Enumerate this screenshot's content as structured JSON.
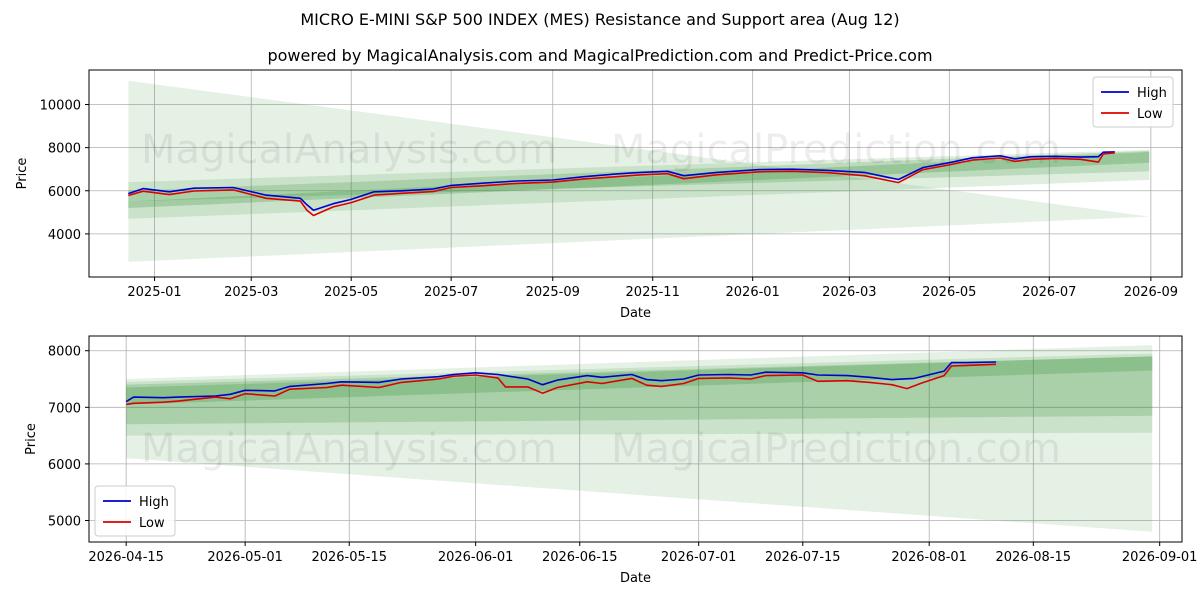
{
  "header": {
    "title": "MICRO E-MINI S&P 500 INDEX (MES) Resistance and Support area (Aug 12)",
    "subtitle": "powered by MagicalAnalysis.com and MagicalPrediction.com and Predict-Price.com"
  },
  "watermark": {
    "left": "MagicalAnalysis.com",
    "right": "MagicalPrediction.com"
  },
  "colors": {
    "high": "#0000cc",
    "low": "#dd0000",
    "band": "#2e8b2e",
    "grid": "#b0b0b0"
  },
  "chart_data": [
    {
      "type": "line",
      "xlabel": "Date",
      "ylabel": "Price",
      "grid": true,
      "legend": "top-right",
      "xticks": [
        "2025-01",
        "2025-03",
        "2025-05",
        "2025-07",
        "2025-09",
        "2025-11",
        "2026-01",
        "2026-03",
        "2026-05",
        "2026-07",
        "2026-09"
      ],
      "yticks": [
        4000,
        6000,
        8000,
        10000
      ],
      "xlim": [
        "2024-11-22",
        "2026-09-20"
      ],
      "ylim": [
        2000,
        11600
      ],
      "series": [
        {
          "name": "High",
          "color": "#0000cc",
          "points": [
            [
              "2024-12-16",
              5870
            ],
            [
              "2024-12-25",
              6100
            ],
            [
              "2025-01-10",
              5950
            ],
            [
              "2025-01-25",
              6120
            ],
            [
              "2025-02-18",
              6150
            ],
            [
              "2025-03-10",
              5800
            ],
            [
              "2025-03-31",
              5650
            ],
            [
              "2025-04-04",
              5350
            ],
            [
              "2025-04-08",
              5100
            ],
            [
              "2025-04-20",
              5400
            ],
            [
              "2025-05-01",
              5600
            ],
            [
              "2025-05-15",
              5950
            ],
            [
              "2025-06-01",
              6000
            ],
            [
              "2025-06-20",
              6080
            ],
            [
              "2025-07-01",
              6250
            ],
            [
              "2025-07-20",
              6350
            ],
            [
              "2025-08-10",
              6450
            ],
            [
              "2025-09-01",
              6500
            ],
            [
              "2025-09-20",
              6650
            ],
            [
              "2025-10-10",
              6780
            ],
            [
              "2025-10-25",
              6850
            ],
            [
              "2025-11-10",
              6900
            ],
            [
              "2025-11-20",
              6700
            ],
            [
              "2025-12-10",
              6850
            ],
            [
              "2026-01-05",
              6980
            ],
            [
              "2026-01-25",
              7000
            ],
            [
              "2026-02-15",
              6950
            ],
            [
              "2026-03-10",
              6850
            ],
            [
              "2026-03-31",
              6520
            ],
            [
              "2026-04-15",
              7080
            ],
            [
              "2026-05-01",
              7300
            ],
            [
              "2026-05-15",
              7530
            ],
            [
              "2026-06-01",
              7620
            ],
            [
              "2026-06-10",
              7480
            ],
            [
              "2026-06-20",
              7580
            ],
            [
              "2026-07-05",
              7600
            ],
            [
              "2026-07-20",
              7560
            ],
            [
              "2026-07-31",
              7580
            ],
            [
              "2026-08-03",
              7790
            ],
            [
              "2026-08-10",
              7800
            ]
          ]
        },
        {
          "name": "Low",
          "color": "#dd0000",
          "points": [
            [
              "2024-12-16",
              5780
            ],
            [
              "2024-12-25",
              5980
            ],
            [
              "2025-01-10",
              5820
            ],
            [
              "2025-01-25",
              5990
            ],
            [
              "2025-02-18",
              6040
            ],
            [
              "2025-03-10",
              5650
            ],
            [
              "2025-03-31",
              5520
            ],
            [
              "2025-04-04",
              5100
            ],
            [
              "2025-04-08",
              4850
            ],
            [
              "2025-04-20",
              5250
            ],
            [
              "2025-05-01",
              5450
            ],
            [
              "2025-05-15",
              5800
            ],
            [
              "2025-06-01",
              5880
            ],
            [
              "2025-06-20",
              5960
            ],
            [
              "2025-07-01",
              6150
            ],
            [
              "2025-07-20",
              6230
            ],
            [
              "2025-08-10",
              6340
            ],
            [
              "2025-09-01",
              6400
            ],
            [
              "2025-09-20",
              6550
            ],
            [
              "2025-10-10",
              6650
            ],
            [
              "2025-10-25",
              6740
            ],
            [
              "2025-11-10",
              6790
            ],
            [
              "2025-11-20",
              6560
            ],
            [
              "2025-12-10",
              6740
            ],
            [
              "2026-01-05",
              6880
            ],
            [
              "2026-01-25",
              6900
            ],
            [
              "2026-02-15",
              6840
            ],
            [
              "2026-03-10",
              6700
            ],
            [
              "2026-03-31",
              6380
            ],
            [
              "2026-04-15",
              6980
            ],
            [
              "2026-05-01",
              7200
            ],
            [
              "2026-05-15",
              7420
            ],
            [
              "2026-06-01",
              7520
            ],
            [
              "2026-06-10",
              7360
            ],
            [
              "2026-06-20",
              7460
            ],
            [
              "2026-07-05",
              7500
            ],
            [
              "2026-07-20",
              7460
            ],
            [
              "2026-07-31",
              7330
            ],
            [
              "2026-08-03",
              7710
            ],
            [
              "2026-08-10",
              7760
            ]
          ]
        }
      ],
      "bands": [
        {
          "x": [
            "2024-12-16",
            "2026-08-31"
          ],
          "upper": [
            11100,
            4800
          ],
          "lower": [
            2700,
            4800
          ],
          "opacity": 0.12
        },
        {
          "x": [
            "2024-12-16",
            "2026-08-31"
          ],
          "upper": [
            6400,
            7900
          ],
          "lower": [
            4700,
            6500
          ],
          "opacity": 0.15
        },
        {
          "x": [
            "2024-12-16",
            "2026-08-31"
          ],
          "upper": [
            6000,
            7850
          ],
          "lower": [
            5500,
            6900
          ],
          "opacity": 0.2
        },
        {
          "x": [
            "2024-12-16",
            "2026-08-31"
          ],
          "upper": [
            5500,
            7800
          ],
          "lower": [
            5200,
            7300
          ],
          "opacity": 0.25
        }
      ]
    },
    {
      "type": "line",
      "xlabel": "Date",
      "ylabel": "Price",
      "grid": true,
      "legend": "bottom-left",
      "xticks": [
        "2026-04-15",
        "2026-05-01",
        "2026-05-15",
        "2026-06-01",
        "2026-06-15",
        "2026-07-01",
        "2026-07-15",
        "2026-08-01",
        "2026-08-15",
        "2026-09-01"
      ],
      "yticks": [
        5000,
        6000,
        7000,
        8000
      ],
      "xlim": [
        "2026-04-10",
        "2026-09-04"
      ],
      "ylim": [
        4620,
        8260
      ],
      "series": [
        {
          "name": "High",
          "color": "#0000cc",
          "points": [
            [
              "2026-04-15",
              7100
            ],
            [
              "2026-04-16",
              7180
            ],
            [
              "2026-04-20",
              7170
            ],
            [
              "2026-04-22",
              7180
            ],
            [
              "2026-04-27",
              7200
            ],
            [
              "2026-04-29",
              7230
            ],
            [
              "2026-05-01",
              7300
            ],
            [
              "2026-05-05",
              7290
            ],
            [
              "2026-05-07",
              7370
            ],
            [
              "2026-05-12",
              7420
            ],
            [
              "2026-05-14",
              7450
            ],
            [
              "2026-05-19",
              7440
            ],
            [
              "2026-05-22",
              7500
            ],
            [
              "2026-05-27",
              7540
            ],
            [
              "2026-05-29",
              7580
            ],
            [
              "2026-06-01",
              7610
            ],
            [
              "2026-06-04",
              7580
            ],
            [
              "2026-06-08",
              7500
            ],
            [
              "2026-06-10",
              7400
            ],
            [
              "2026-06-12",
              7480
            ],
            [
              "2026-06-16",
              7560
            ],
            [
              "2026-06-18",
              7530
            ],
            [
              "2026-06-22",
              7580
            ],
            [
              "2026-06-24",
              7490
            ],
            [
              "2026-06-26",
              7470
            ],
            [
              "2026-06-29",
              7500
            ],
            [
              "2026-07-01",
              7570
            ],
            [
              "2026-07-05",
              7580
            ],
            [
              "2026-07-08",
              7570
            ],
            [
              "2026-07-10",
              7620
            ],
            [
              "2026-07-15",
              7610
            ],
            [
              "2026-07-17",
              7570
            ],
            [
              "2026-07-21",
              7560
            ],
            [
              "2026-07-24",
              7530
            ],
            [
              "2026-07-27",
              7490
            ],
            [
              "2026-07-30",
              7510
            ],
            [
              "2026-08-03",
              7640
            ],
            [
              "2026-08-04",
              7790
            ],
            [
              "2026-08-06",
              7790
            ],
            [
              "2026-08-10",
              7800
            ]
          ]
        },
        {
          "name": "Low",
          "color": "#dd0000",
          "points": [
            [
              "2026-04-15",
              7050
            ],
            [
              "2026-04-16",
              7070
            ],
            [
              "2026-04-20",
              7090
            ],
            [
              "2026-04-22",
              7110
            ],
            [
              "2026-04-27",
              7180
            ],
            [
              "2026-04-29",
              7150
            ],
            [
              "2026-05-01",
              7240
            ],
            [
              "2026-05-05",
              7200
            ],
            [
              "2026-05-07",
              7320
            ],
            [
              "2026-05-12",
              7350
            ],
            [
              "2026-05-14",
              7390
            ],
            [
              "2026-05-19",
              7350
            ],
            [
              "2026-05-22",
              7440
            ],
            [
              "2026-05-27",
              7500
            ],
            [
              "2026-05-29",
              7550
            ],
            [
              "2026-06-01",
              7570
            ],
            [
              "2026-06-04",
              7520
            ],
            [
              "2026-06-05",
              7360
            ],
            [
              "2026-06-08",
              7360
            ],
            [
              "2026-06-10",
              7250
            ],
            [
              "2026-06-12",
              7350
            ],
            [
              "2026-06-16",
              7450
            ],
            [
              "2026-06-18",
              7420
            ],
            [
              "2026-06-22",
              7510
            ],
            [
              "2026-06-24",
              7390
            ],
            [
              "2026-06-26",
              7370
            ],
            [
              "2026-06-29",
              7420
            ],
            [
              "2026-07-01",
              7510
            ],
            [
              "2026-07-05",
              7520
            ],
            [
              "2026-07-08",
              7500
            ],
            [
              "2026-07-10",
              7560
            ],
            [
              "2026-07-15",
              7570
            ],
            [
              "2026-07-17",
              7460
            ],
            [
              "2026-07-21",
              7470
            ],
            [
              "2026-07-24",
              7440
            ],
            [
              "2026-07-27",
              7400
            ],
            [
              "2026-07-29",
              7330
            ],
            [
              "2026-07-31",
              7430
            ],
            [
              "2026-08-03",
              7560
            ],
            [
              "2026-08-04",
              7730
            ],
            [
              "2026-08-06",
              7740
            ],
            [
              "2026-08-10",
              7760
            ]
          ]
        }
      ],
      "bands": [
        {
          "x": [
            "2026-04-15",
            "2026-08-31"
          ],
          "upper": [
            7500,
            8100
          ],
          "lower": [
            6100,
            4800
          ],
          "opacity": 0.12
        },
        {
          "x": [
            "2026-04-15",
            "2026-08-31"
          ],
          "upper": [
            7450,
            7950
          ],
          "lower": [
            6500,
            6550
          ],
          "opacity": 0.15
        },
        {
          "x": [
            "2026-04-15",
            "2026-08-31"
          ],
          "upper": [
            7400,
            7900
          ],
          "lower": [
            6700,
            6850
          ],
          "opacity": 0.2
        },
        {
          "x": [
            "2026-04-15",
            "2026-08-31"
          ],
          "upper": [
            7350,
            7900
          ],
          "lower": [
            7050,
            7650
          ],
          "opacity": 0.25
        }
      ]
    }
  ]
}
